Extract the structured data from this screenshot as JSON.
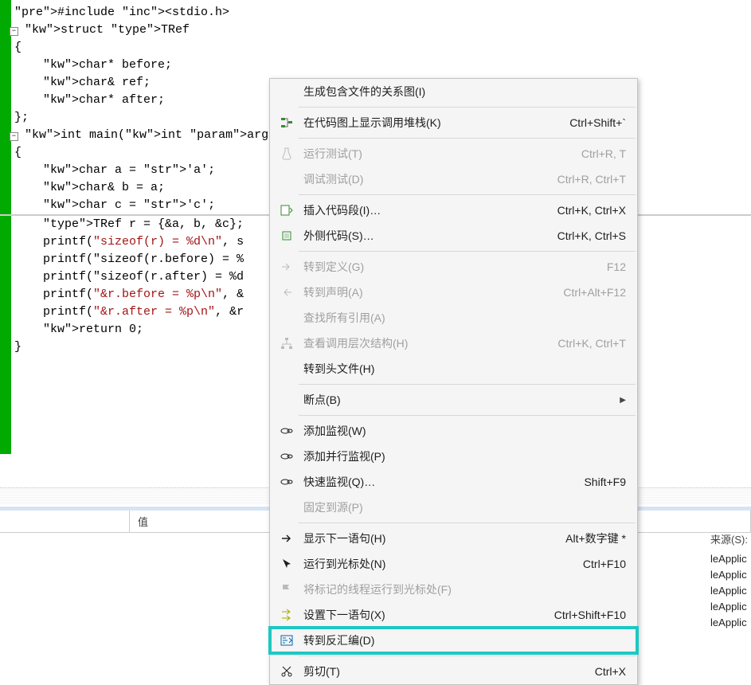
{
  "code": {
    "lines": [
      "#include <stdio.h>",
      "",
      "struct TRef",
      "{",
      "    char* before;",
      "    char& ref;",
      "    char* after;",
      "};",
      "",
      "int main(int argc, char* argv[])",
      "{",
      "    char a = 'a';",
      "    char& b = a;",
      "    char c = 'c';",
      "",
      "    TRef r = {&a, b, &c};",
      "",
      "    printf(\"sizeof(r) = %d\\n\", s",
      "    printf(\"sizeof(r.before) = %",
      "    printf(\"sizeof(r.after) = %d",
      "    printf(\"&r.before = %p\\n\", &",
      "    printf(\"&r.after = %p\\n\", &r",
      "",
      "    return 0;",
      "}"
    ]
  },
  "menu": {
    "items": [
      {
        "icon": "",
        "label": "生成包含文件的关系图(I)",
        "shortcut": "",
        "disabled": false,
        "highlight": false,
        "sub": false
      },
      {
        "sep": true
      },
      {
        "icon": "callstack",
        "label": "在代码图上显示调用堆栈(K)",
        "shortcut": "Ctrl+Shift+`",
        "disabled": false,
        "highlight": false,
        "sub": false
      },
      {
        "sep": true
      },
      {
        "icon": "flask",
        "label": "运行测试(T)",
        "shortcut": "Ctrl+R, T",
        "disabled": true,
        "highlight": false,
        "sub": false
      },
      {
        "icon": "",
        "label": "调试测试(D)",
        "shortcut": "Ctrl+R, Ctrl+T",
        "disabled": true,
        "highlight": false,
        "sub": false
      },
      {
        "sep": true
      },
      {
        "icon": "snippet",
        "label": "插入代码段(I)…",
        "shortcut": "Ctrl+K, Ctrl+X",
        "disabled": false,
        "highlight": false,
        "sub": false
      },
      {
        "icon": "surround",
        "label": "外侧代码(S)…",
        "shortcut": "Ctrl+K, Ctrl+S",
        "disabled": false,
        "highlight": false,
        "sub": false
      },
      {
        "sep": true
      },
      {
        "icon": "godef",
        "label": "转到定义(G)",
        "shortcut": "F12",
        "disabled": true,
        "highlight": false,
        "sub": false
      },
      {
        "icon": "godecl",
        "label": "转到声明(A)",
        "shortcut": "Ctrl+Alt+F12",
        "disabled": true,
        "highlight": false,
        "sub": false
      },
      {
        "icon": "",
        "label": "查找所有引用(A)",
        "shortcut": "",
        "disabled": true,
        "highlight": false,
        "sub": false
      },
      {
        "icon": "hier",
        "label": "查看调用层次结构(H)",
        "shortcut": "Ctrl+K, Ctrl+T",
        "disabled": true,
        "highlight": false,
        "sub": false
      },
      {
        "icon": "",
        "label": "转到头文件(H)",
        "shortcut": "",
        "disabled": false,
        "highlight": false,
        "sub": false
      },
      {
        "sep": true
      },
      {
        "icon": "",
        "label": "断点(B)",
        "shortcut": "",
        "disabled": false,
        "highlight": false,
        "sub": true
      },
      {
        "sep": true
      },
      {
        "icon": "watch",
        "label": "添加监视(W)",
        "shortcut": "",
        "disabled": false,
        "highlight": false,
        "sub": false
      },
      {
        "icon": "watch",
        "label": "添加并行监视(P)",
        "shortcut": "",
        "disabled": false,
        "highlight": false,
        "sub": false
      },
      {
        "icon": "watch",
        "label": "快速监视(Q)…",
        "shortcut": "Shift+F9",
        "disabled": false,
        "highlight": false,
        "sub": false
      },
      {
        "icon": "",
        "label": "固定到源(P)",
        "shortcut": "",
        "disabled": true,
        "highlight": false,
        "sub": false
      },
      {
        "sep": true
      },
      {
        "icon": "arrow-right",
        "label": "显示下一语句(H)",
        "shortcut": "Alt+数字键 *",
        "disabled": false,
        "highlight": false,
        "sub": false
      },
      {
        "icon": "cursor",
        "label": "运行到光标处(N)",
        "shortcut": "Ctrl+F10",
        "disabled": false,
        "highlight": false,
        "sub": false
      },
      {
        "icon": "flag",
        "label": "将标记的线程运行到光标处(F)",
        "shortcut": "",
        "disabled": true,
        "highlight": false,
        "sub": false
      },
      {
        "icon": "setnext",
        "label": "设置下一语句(X)",
        "shortcut": "Ctrl+Shift+F10",
        "disabled": false,
        "highlight": false,
        "sub": false
      },
      {
        "icon": "disasm",
        "label": "转到反汇编(D)",
        "shortcut": "",
        "disabled": false,
        "highlight": true,
        "sub": false
      },
      {
        "sep": true
      },
      {
        "icon": "cut",
        "label": "剪切(T)",
        "shortcut": "Ctrl+X",
        "disabled": false,
        "highlight": false,
        "sub": false
      }
    ]
  },
  "bottom": {
    "cols": {
      "name": "",
      "value": "值"
    },
    "right_label": "来源(S):",
    "right_rows": [
      "leApplic",
      "leApplic",
      "leApplic",
      "leApplic",
      "leApplic"
    ]
  }
}
